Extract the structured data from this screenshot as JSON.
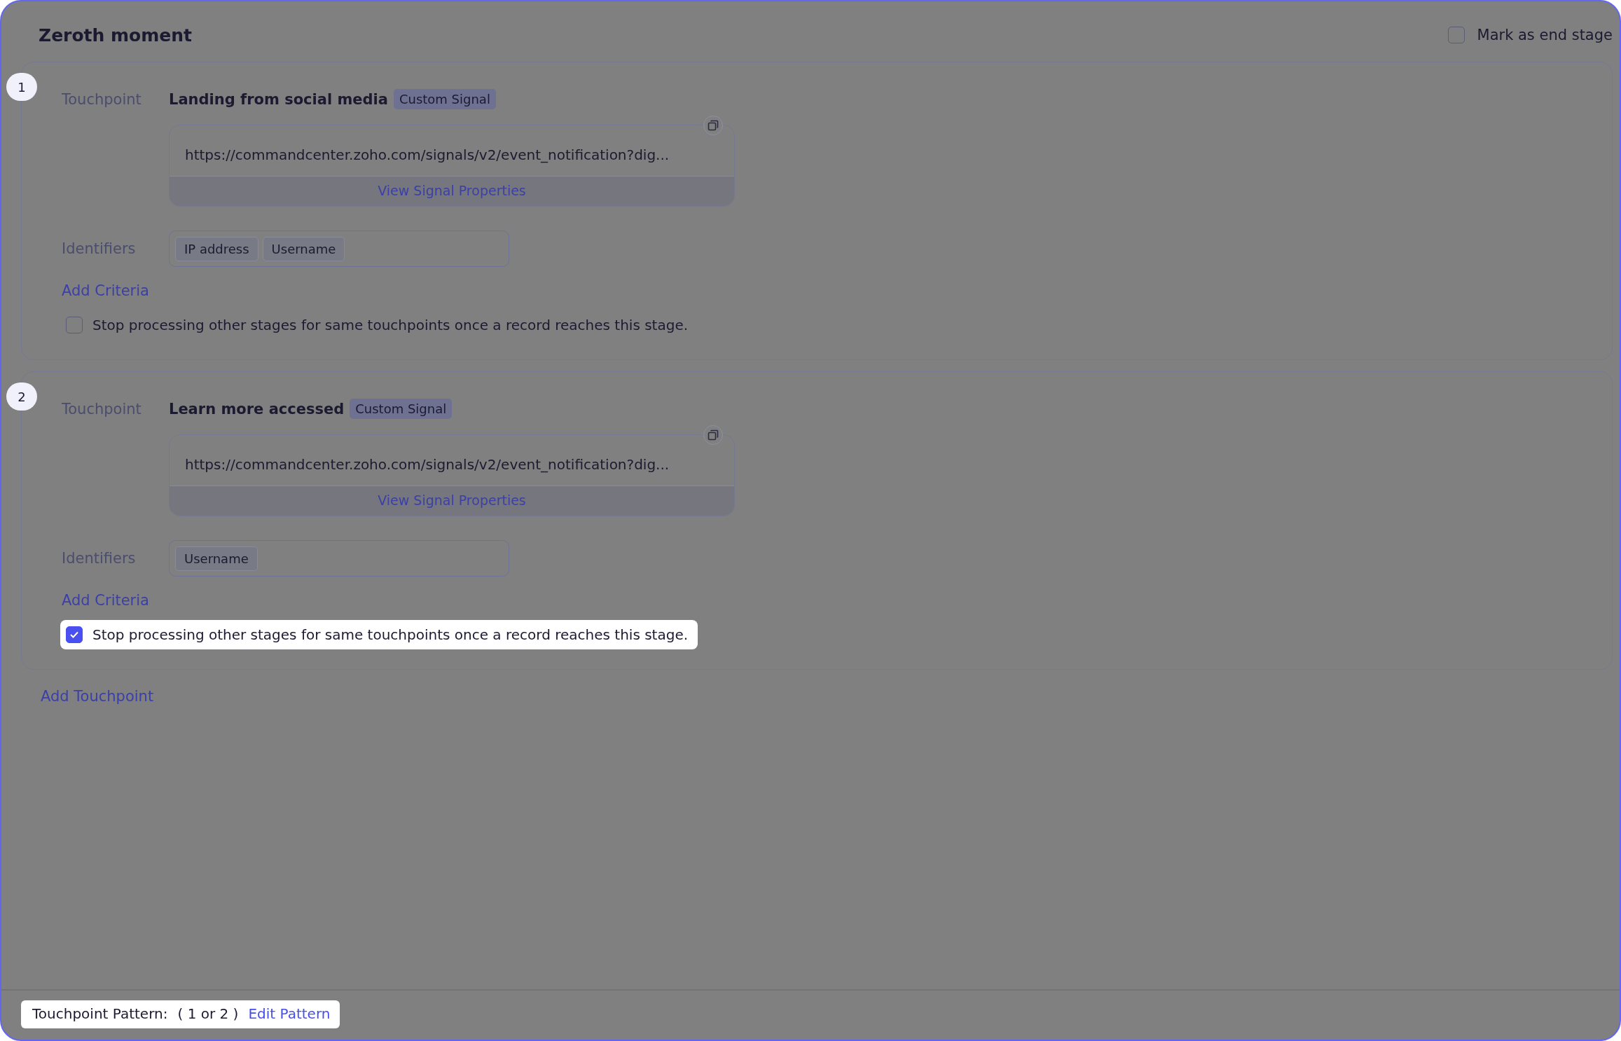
{
  "stage": {
    "title": "Zeroth moment",
    "end_stage": {
      "label": "Mark as end stage",
      "checked": false
    }
  },
  "touchpoints": [
    {
      "number": "1",
      "label": "Touchpoint",
      "name": "Landing from social media",
      "tag": "Custom Signal",
      "url": "https://commandcenter.zoho.com/signals/v2/event_notification?dig...",
      "view_link": "View Signal Properties",
      "identifiers_label": "Identifiers",
      "identifiers": [
        "IP address",
        "Username"
      ],
      "add_criteria": "Add Criteria",
      "stop_processing": {
        "label": "Stop processing other stages for same touchpoints once a record reaches this stage.",
        "checked": false,
        "highlighted": false
      }
    },
    {
      "number": "2",
      "label": "Touchpoint",
      "name": "Learn more accessed",
      "tag": "Custom Signal",
      "url": "https://commandcenter.zoho.com/signals/v2/event_notification?dig...",
      "view_link": "View Signal Properties",
      "identifiers_label": "Identifiers",
      "identifiers": [
        "Username"
      ],
      "add_criteria": "Add Criteria",
      "stop_processing": {
        "label": "Stop processing other stages for same touchpoints once a record reaches this stage.",
        "checked": true,
        "highlighted": true
      }
    }
  ],
  "add_touchpoint": "Add Touchpoint",
  "footer": {
    "label": "Touchpoint Pattern:",
    "pattern": "( 1 or 2 )",
    "edit_link": "Edit Pattern"
  }
}
